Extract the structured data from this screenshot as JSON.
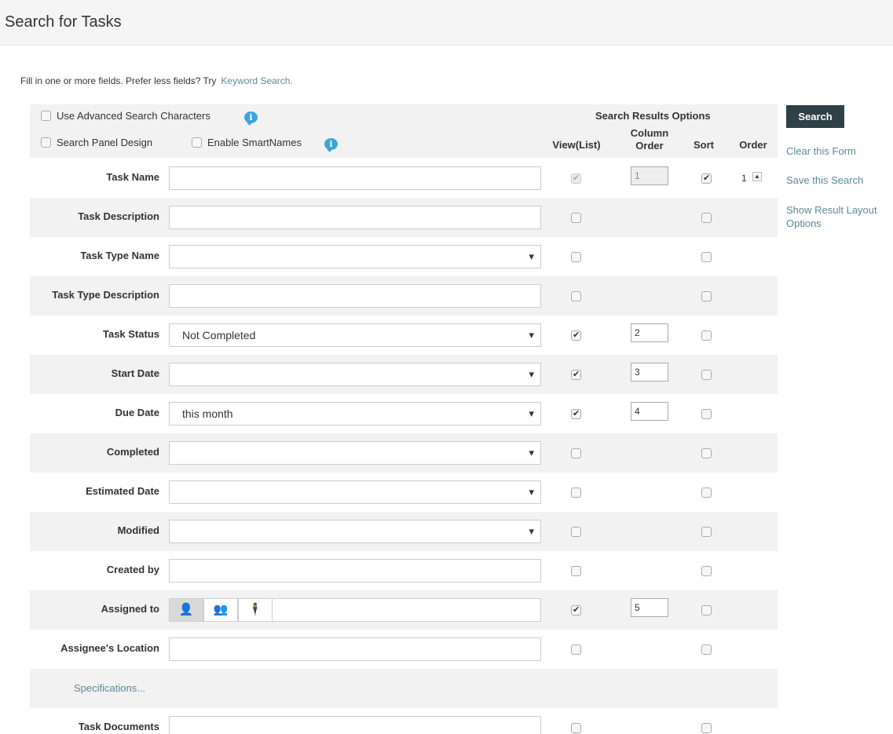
{
  "header": {
    "title": "Search for Tasks"
  },
  "intro": {
    "text": "Fill in one or more fields. Prefer less fields? Try",
    "link": "Keyword Search."
  },
  "options": {
    "advanced_chars": "Use Advanced Search Characters",
    "panel_design": "Search Panel Design",
    "smartnames": "Enable SmartNames"
  },
  "results_options": {
    "title": "Search Results Options",
    "view_list": "View(List)",
    "column_order_line1": "Column",
    "column_order_line2": "Order",
    "sort": "Sort",
    "order": "Order"
  },
  "rows": [
    {
      "label": "Task Name",
      "value": "",
      "view": true,
      "column_order": "1",
      "sort": true,
      "order": "1"
    },
    {
      "label": "Task Description",
      "value": ""
    },
    {
      "label": "Task Type Name",
      "value": ""
    },
    {
      "label": "Task Type Description",
      "value": ""
    },
    {
      "label": "Task Status",
      "value": "Not Completed",
      "column_order": "2"
    },
    {
      "label": "Start Date",
      "value": "",
      "column_order": "3"
    },
    {
      "label": "Due Date",
      "value": "this month",
      "column_order": "4"
    },
    {
      "label": "Completed",
      "value": ""
    },
    {
      "label": "Estimated Date",
      "value": ""
    },
    {
      "label": "Modified",
      "value": ""
    },
    {
      "label": "Created by",
      "value": ""
    },
    {
      "label": "Assigned to",
      "value": "",
      "column_order": "5"
    },
    {
      "label": "Assignee's Location",
      "value": ""
    },
    {
      "label": "Specifications..."
    },
    {
      "label": "Task Documents",
      "value": ""
    }
  ],
  "side": {
    "search": "Search",
    "clear": "Clear this Form",
    "save": "Save this Search",
    "layout": "Show Result Layout Options"
  },
  "colors": {
    "accent": "#2f4148",
    "link": "#5a8a99",
    "info": "#3aa5d8"
  }
}
